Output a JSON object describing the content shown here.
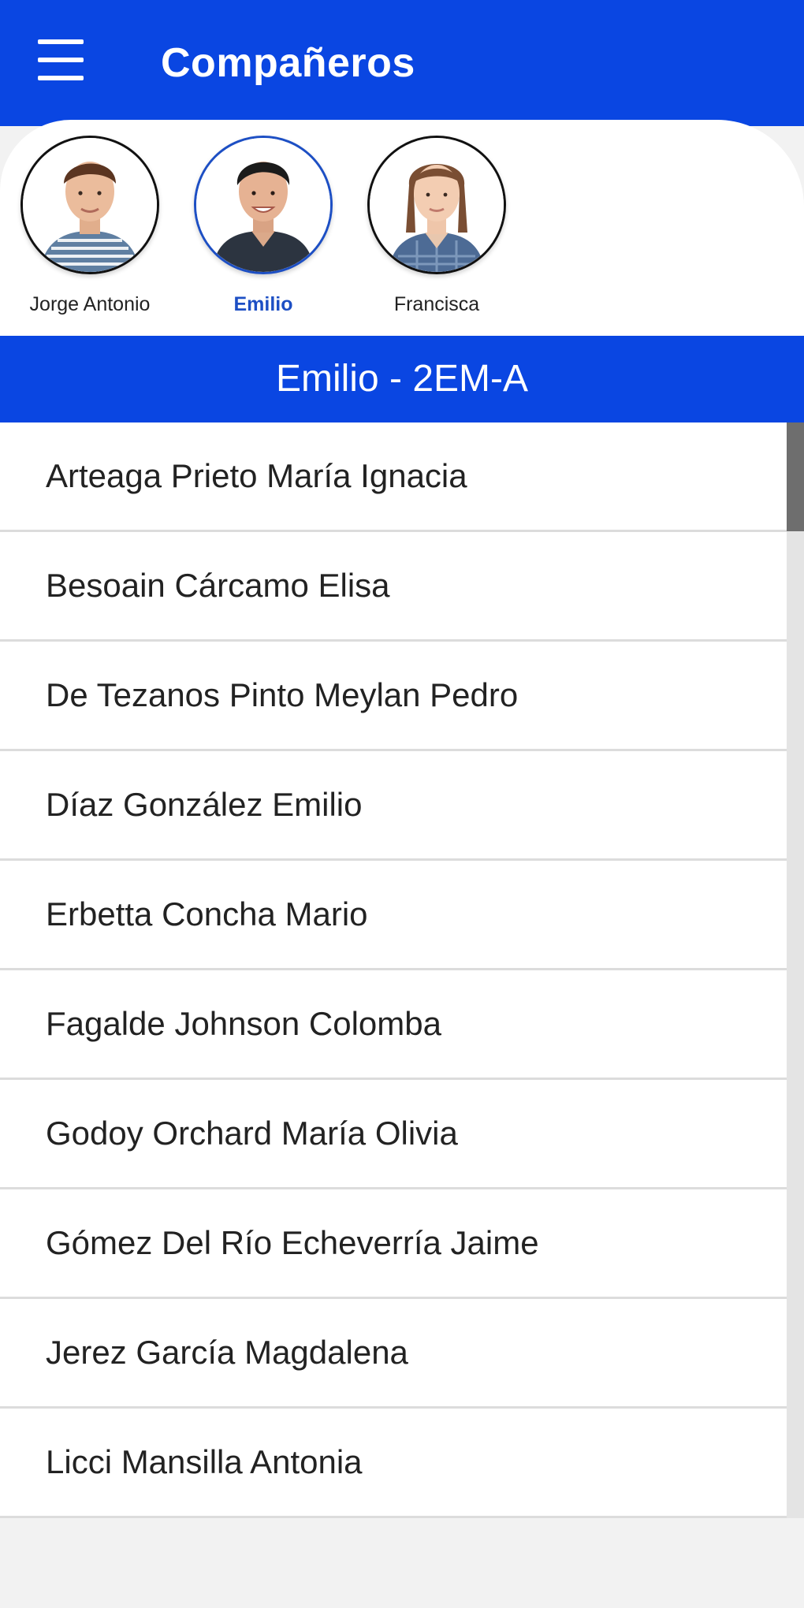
{
  "header": {
    "title": "Compañeros",
    "menu_icon": "hamburger-menu-icon"
  },
  "students": [
    {
      "name": "Jorge Antonio",
      "selected": false
    },
    {
      "name": "Emilio",
      "selected": true
    },
    {
      "name": "Francisca",
      "selected": false
    }
  ],
  "section": {
    "title": "Emilio - 2EM-A"
  },
  "classmates": [
    "Arteaga Prieto María Ignacia",
    "Besoain Cárcamo Elisa",
    "De Tezanos Pinto Meylan Pedro",
    "Díaz González Emilio",
    "Erbetta Concha Mario",
    "Fagalde Johnson Colomba",
    "Godoy Orchard María Olivia",
    "Gómez Del Río Echeverría Jaime",
    "Jerez García Magdalena",
    "Licci Mansilla Antonia"
  ],
  "colors": {
    "primary": "#0a46e2",
    "selected_text": "#1d4fc4",
    "list_text": "#222222",
    "divider": "#dcdcdc"
  }
}
